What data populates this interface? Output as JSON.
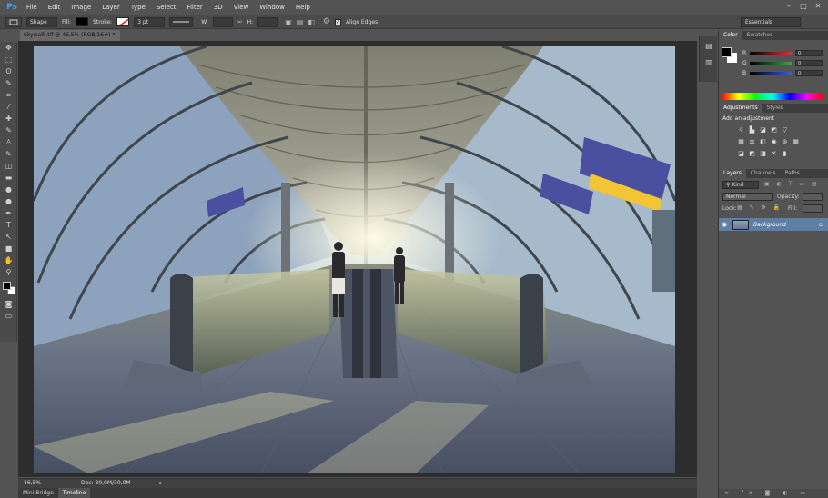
{
  "app": {
    "logo_text": "Ps"
  },
  "menu": [
    "File",
    "Edit",
    "Image",
    "Layer",
    "Type",
    "Select",
    "Filter",
    "3D",
    "View",
    "Window",
    "Help"
  ],
  "window_controls": [
    "–",
    "□",
    "✕"
  ],
  "options_bar": {
    "tool_mode": "Shape",
    "fill_label": "Fill:",
    "stroke_label": "Stroke:",
    "stroke_width": "3 pt",
    "w_label": "W:",
    "h_label": "H:",
    "align_edges_label": "Align Edges",
    "workspace": "Essentials"
  },
  "document": {
    "tab_title": "Skywalk.tif @ 46,5% (RGB/16#) *",
    "tab_close": "×",
    "zoom": "46,5%",
    "doc_info": "Doc: 30,0M/30,0M"
  },
  "bottom_tabs": [
    "Mini Bridge",
    "Timeline"
  ],
  "tools": [
    "move-icon",
    "marquee-icon",
    "lasso-icon",
    "quick-select-icon",
    "crop-icon",
    "eyedropper-icon",
    "healing-icon",
    "brush-icon",
    "stamp-icon",
    "history-brush-icon",
    "eraser-icon",
    "gradient-icon",
    "blur-icon",
    "dodge-icon",
    "pen-icon",
    "type-icon",
    "path-select-icon",
    "shape-icon",
    "hand-icon",
    "zoom-icon"
  ],
  "tool_glyphs": [
    "✥",
    "⬚",
    "ʘ",
    "✎",
    "⌗",
    "⁄",
    "✚",
    "✎",
    "♙",
    "✎",
    "◫",
    "▬",
    "●",
    "●",
    "✒",
    "T",
    "↖",
    "■",
    "✋",
    "⚲"
  ],
  "panels": {
    "color_tabs": [
      "Color",
      "Swatches"
    ],
    "channels": [
      {
        "label": "R",
        "value": "0",
        "color": "#d83333"
      },
      {
        "label": "G",
        "value": "0",
        "color": "#2eae3c"
      },
      {
        "label": "B",
        "value": "0",
        "color": "#3a5bd8"
      }
    ],
    "adjust_tabs": [
      "Adjustments",
      "Styles"
    ],
    "add_adjustment": "Add an adjustment",
    "layers_tabs": [
      "Layers",
      "Channels",
      "Paths"
    ],
    "kind_label": "Kind",
    "blend_mode": "Normal",
    "opacity_label": "Opacity:",
    "lock_label": "Lock:",
    "fill_label": "Fill:",
    "layer_name": "Background"
  }
}
